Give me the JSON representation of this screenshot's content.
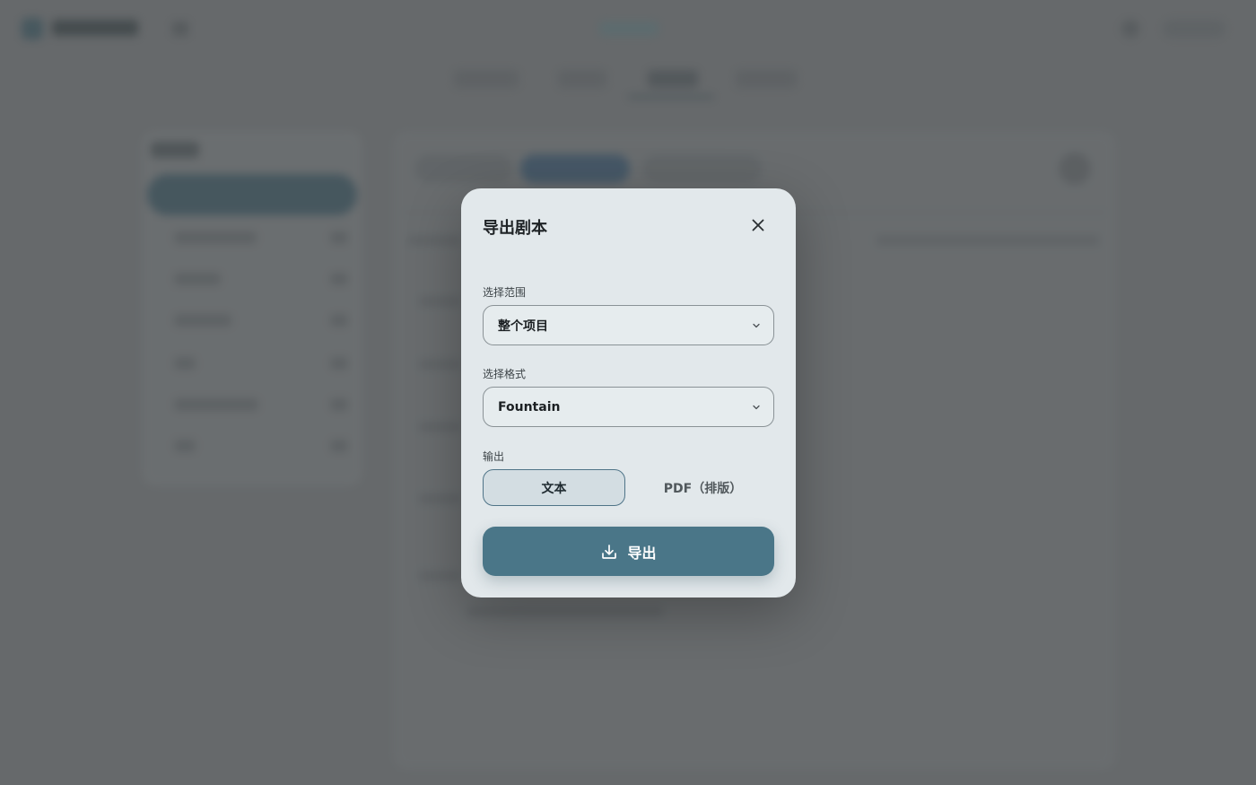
{
  "modal": {
    "title": "导出剧本",
    "close_icon": "close-icon",
    "scope": {
      "label": "选择范围",
      "value": "整个项目"
    },
    "format": {
      "label": "选择格式",
      "value": "Fountain"
    },
    "output": {
      "label": "输出",
      "options": [
        "文本",
        "PDF（排版）"
      ],
      "selected": "文本"
    },
    "export_button": {
      "label": "导出",
      "icon": "download-icon"
    }
  },
  "colors": {
    "overlay": "#66696b",
    "modal_bg": "#e2e8eb",
    "accent": "#4a7688",
    "selected_border": "#4f7488"
  }
}
